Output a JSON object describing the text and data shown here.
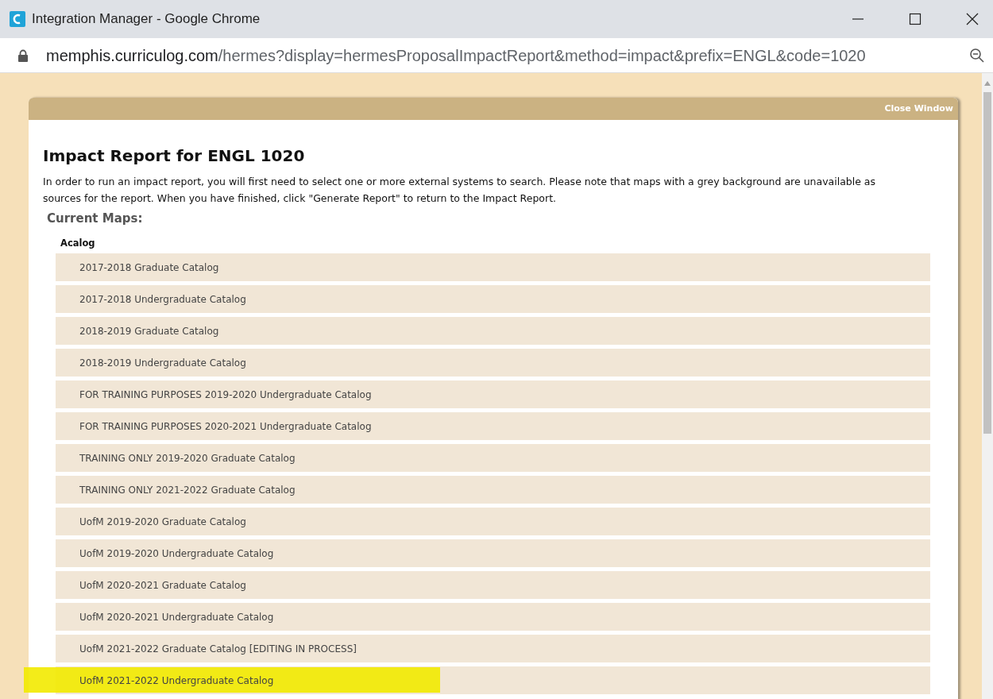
{
  "window": {
    "title": "Integration Manager - Google Chrome"
  },
  "address_bar": {
    "domain": "memphis.curriculog.com",
    "path": "/hermes?display=hermesProposalImpactReport&method=impact&prefix=ENGL&code=1020"
  },
  "panel": {
    "close_link": "Close Window",
    "heading": "Impact Report for ENGL 1020",
    "intro": "In order to run an impact report, you will first need to select one or more external systems to search. Please note that maps with a grey background are unavailable as sources for the report. When you have finished, click \"Generate Report\" to return to the Impact Report.",
    "section_title": "Current Maps:",
    "group_label": "Acalog",
    "maps": [
      {
        "label": "2017-2018 Graduate Catalog",
        "highlighted": false
      },
      {
        "label": "2017-2018 Undergraduate Catalog",
        "highlighted": false
      },
      {
        "label": "2018-2019 Graduate Catalog",
        "highlighted": false
      },
      {
        "label": "2018-2019 Undergraduate Catalog",
        "highlighted": false
      },
      {
        "label": "FOR TRAINING PURPOSES 2019-2020 Undergraduate Catalog",
        "highlighted": false
      },
      {
        "label": "FOR TRAINING PURPOSES 2020-2021 Undergraduate Catalog",
        "highlighted": false
      },
      {
        "label": "TRAINING ONLY 2019-2020 Graduate Catalog",
        "highlighted": false
      },
      {
        "label": "TRAINING ONLY 2021-2022 Graduate Catalog",
        "highlighted": false
      },
      {
        "label": "UofM 2019-2020 Graduate Catalog",
        "highlighted": false
      },
      {
        "label": "UofM 2019-2020 Undergraduate Catalog",
        "highlighted": false
      },
      {
        "label": "UofM 2020-2021 Graduate Catalog",
        "highlighted": false
      },
      {
        "label": "UofM 2020-2021 Undergraduate Catalog",
        "highlighted": false
      },
      {
        "label": "UofM 2021-2022 Graduate Catalog [EDITING IN PROCESS]",
        "highlighted": false
      },
      {
        "label": "UofM 2021-2022 Undergraduate Catalog",
        "highlighted": true
      }
    ]
  }
}
